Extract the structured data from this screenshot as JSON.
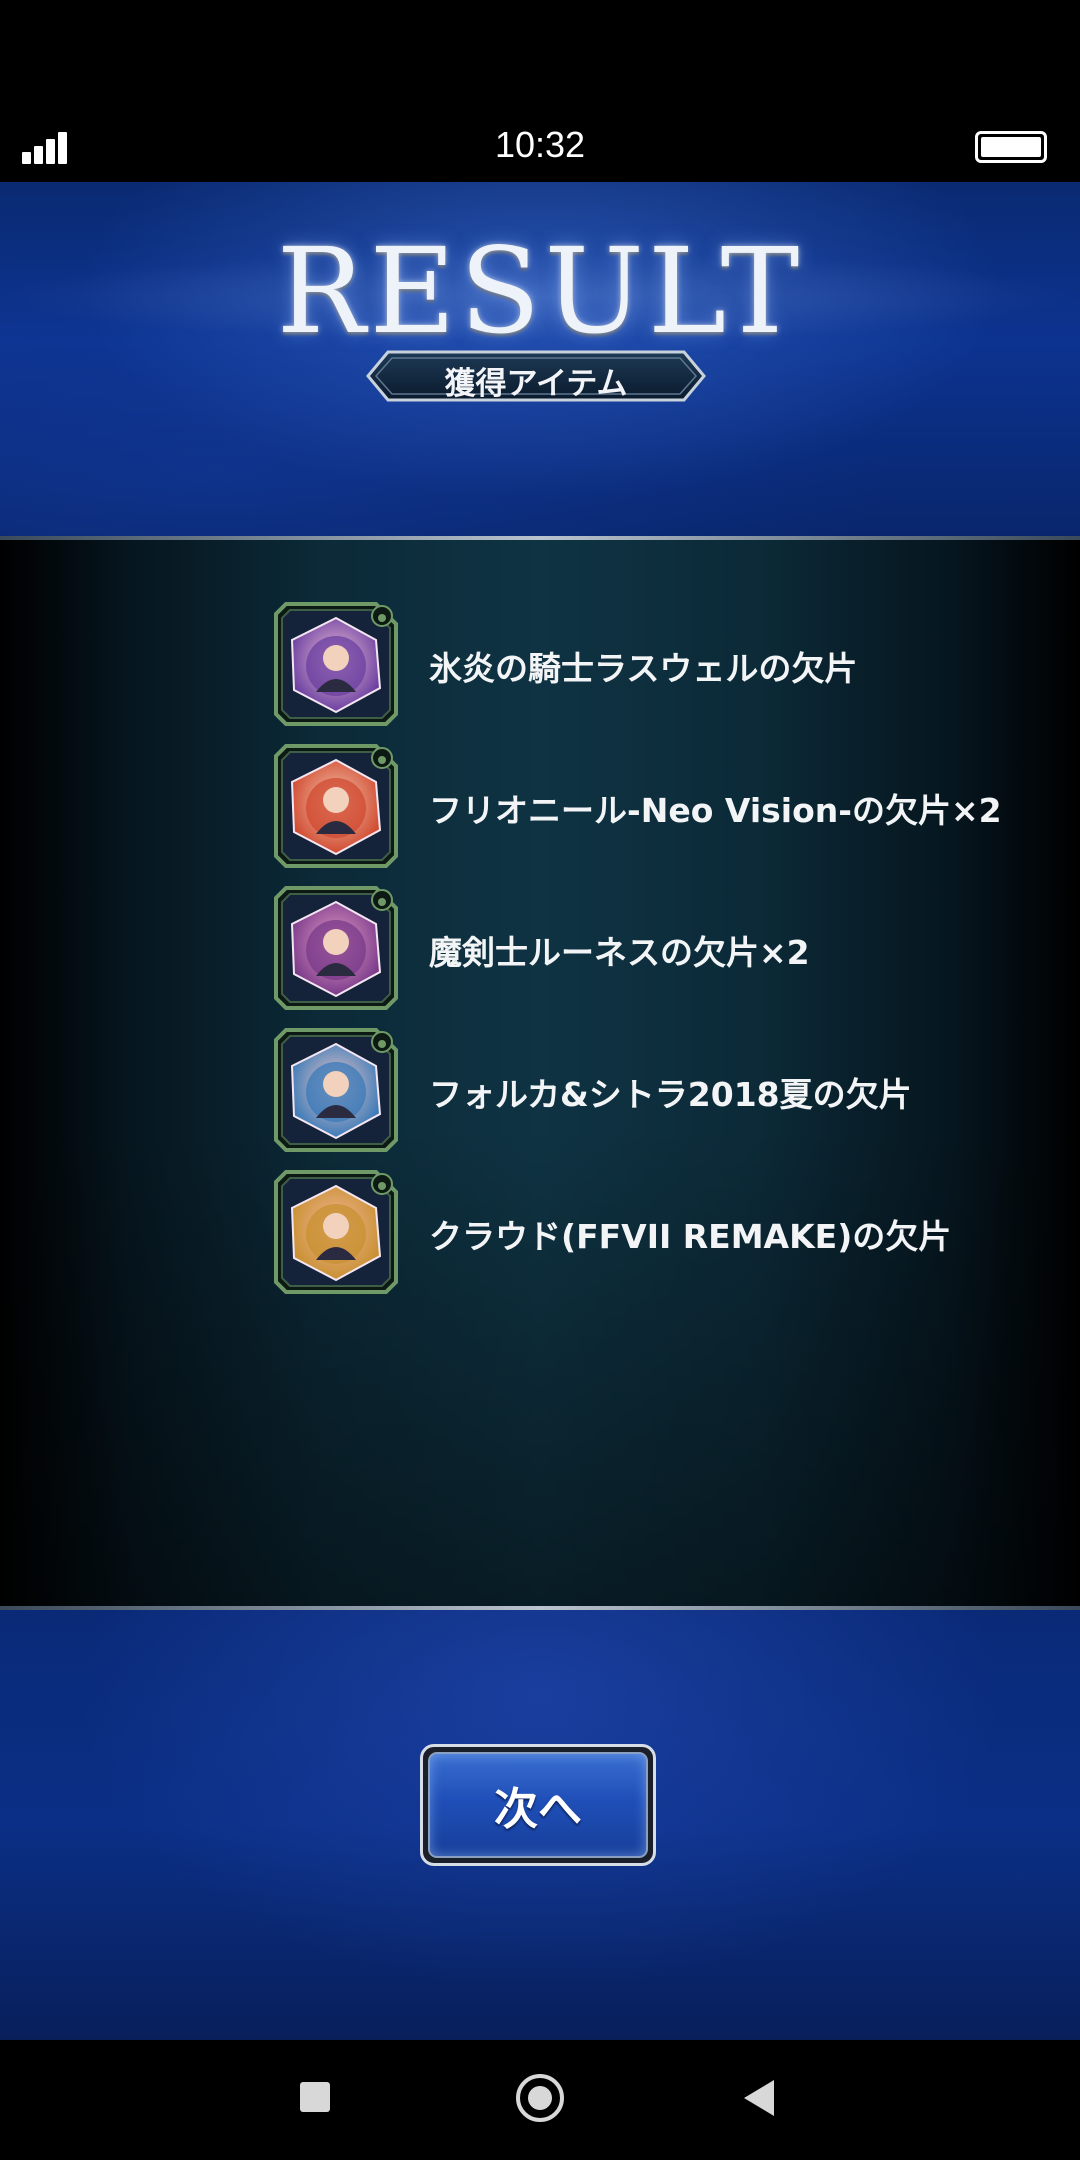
{
  "status_bar": {
    "time": "10:32",
    "signal_level": 3
  },
  "header": {
    "title": "RESULT",
    "subtitle": "獲得アイテム"
  },
  "items": [
    {
      "label": "氷炎の騎士ラスウェルの欠片",
      "icon": "character-shard-icon",
      "colors": [
        "#6a3fa0",
        "#f0c0d8"
      ]
    },
    {
      "label": "フリオニール-Neo Vision-の欠片×2",
      "icon": "character-shard-icon",
      "colors": [
        "#d04a30",
        "#f4c8b0"
      ]
    },
    {
      "label": "魔剣士ルーネスの欠片×2",
      "icon": "character-shard-icon",
      "colors": [
        "#7a3a8a",
        "#e8a0c8"
      ]
    },
    {
      "label": "フォルカ&シトラ2018夏の欠片",
      "icon": "character-shard-icon",
      "colors": [
        "#3a7ab8",
        "#f0c8c8"
      ]
    },
    {
      "label": "クラウド(FFVII REMAKE)の欠片",
      "icon": "character-shard-icon",
      "colors": [
        "#c89030",
        "#f4b8a0"
      ]
    }
  ],
  "footer": {
    "next_label": "次へ"
  },
  "nav": {
    "recent": "recent-apps-icon",
    "home": "home-icon",
    "back": "back-icon"
  },
  "colors": {
    "header_blue": "#0c3390",
    "panel_teal": "#0f3343",
    "button_blue": "#1f4fb8",
    "icon_frame_green": "#6f9a68"
  }
}
